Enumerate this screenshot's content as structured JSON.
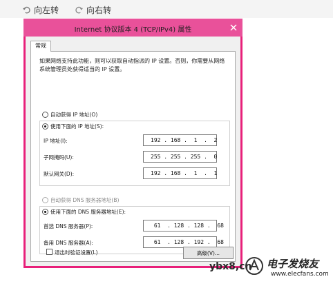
{
  "toolbar": {
    "rotate_left": "向左转",
    "rotate_right": "向右转"
  },
  "dialog": {
    "title": "Internet 协议版本 4 (TCP/IPv4) 属性",
    "tab_label": "常规",
    "description": "如果网络支持此功能，则可以获取自动指派的 IP 设置。否则，你需要从网络系统管理员处获得适当的 IP 设置。",
    "ip_section": {
      "auto_label": "自动获得 IP 地址(O)",
      "manual_label": "使用下面的 IP 地址(S):",
      "fields": [
        {
          "label": "IP 地址(I):",
          "value": "192 . 168 .  1  .  2"
        },
        {
          "label": "子网掩码(U):",
          "value": "255 . 255 . 255 .  0"
        },
        {
          "label": "默认网关(D):",
          "value": "192 . 168 .  1  .  1"
        }
      ]
    },
    "dns_section": {
      "auto_label": "自动获得 DNS 服务器地址(B)",
      "manual_label": "使用下面的 DNS 服务器地址(E):",
      "fields": [
        {
          "label": "首选 DNS 服务器(P):",
          "value": " 61  . 128 . 128 .  68"
        },
        {
          "label": "备用 DNS 服务器(A):",
          "value": " 61  . 128 . 192 .  68"
        }
      ]
    },
    "validate_label": "退出时验证设置(L)",
    "advanced_label": "高级(V)..."
  },
  "watermark": {
    "left_text": "ybx8,cn",
    "cn_text": "电子发烧友",
    "url": "www.elecfans.com"
  },
  "colors": {
    "frame": "#e8207a",
    "titlebar": "#e9519a"
  }
}
